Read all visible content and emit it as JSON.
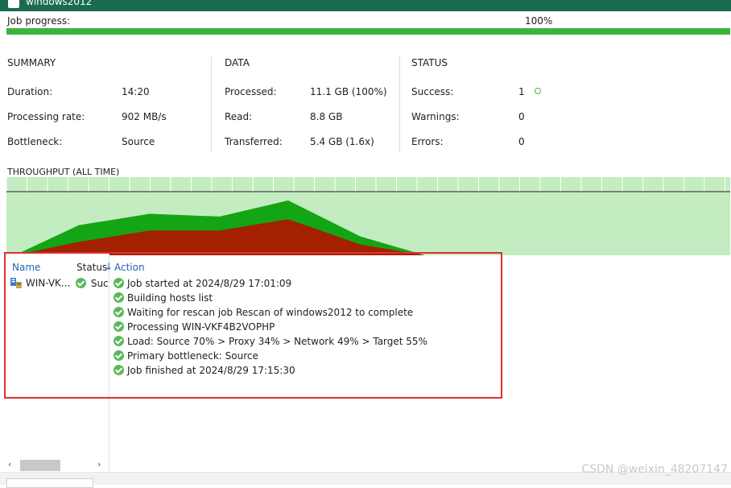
{
  "window": {
    "title": "windows2012"
  },
  "progress": {
    "label": "Job progress:",
    "value_text": "100%",
    "percent": 100
  },
  "summary": {
    "heading": "SUMMARY",
    "rows": [
      {
        "label": "Duration:",
        "value": "14:20"
      },
      {
        "label": "Processing rate:",
        "value": "902 MB/s"
      },
      {
        "label": "Bottleneck:",
        "value": "Source"
      }
    ]
  },
  "data": {
    "heading": "DATA",
    "rows": [
      {
        "label": "Processed:",
        "value": "11.1 GB (100%)"
      },
      {
        "label": "Read:",
        "value": "8.8 GB"
      },
      {
        "label": "Transferred:",
        "value": "5.4 GB (1.6x)"
      }
    ]
  },
  "status": {
    "heading": "STATUS",
    "rows": [
      {
        "label": "Success:",
        "value": "1"
      },
      {
        "label": "Warnings:",
        "value": "0"
      },
      {
        "label": "Errors:",
        "value": "0"
      }
    ]
  },
  "throughput": {
    "title": "THROUGHPUT (ALL TIME)",
    "colors": {
      "background": "#c3ecc0",
      "grid": "#ffffff",
      "read": "#14a514",
      "transfer": "#a32000",
      "baseline": "#222222"
    },
    "read_series": [
      0,
      0.45,
      0.62,
      0.58,
      0.82,
      0.28,
      0
    ],
    "transfer_series": [
      0,
      0.2,
      0.37,
      0.37,
      0.54,
      0.16,
      0
    ]
  },
  "vm_list": {
    "headers": {
      "name": "Name",
      "status": "Status"
    },
    "rows": [
      {
        "name": "WIN-VK...",
        "status": "Succ"
      }
    ]
  },
  "log": {
    "header": "Action",
    "entries": [
      "Job started at 2024/8/29 17:01:09",
      "Building hosts list",
      "Waiting for rescan job Rescan of windows2012 to complete",
      "Processing WIN-VKF4B2VOPHP",
      "Load: Source 70% > Proxy 34% > Network 49% > Target 55%",
      "Primary bottleneck: Source",
      "Job finished at 2024/8/29 17:15:30"
    ]
  },
  "scrollbar": {
    "left_arrow": "‹",
    "right_arrow": "›"
  },
  "watermark": "CSDN @weixin_48207147"
}
